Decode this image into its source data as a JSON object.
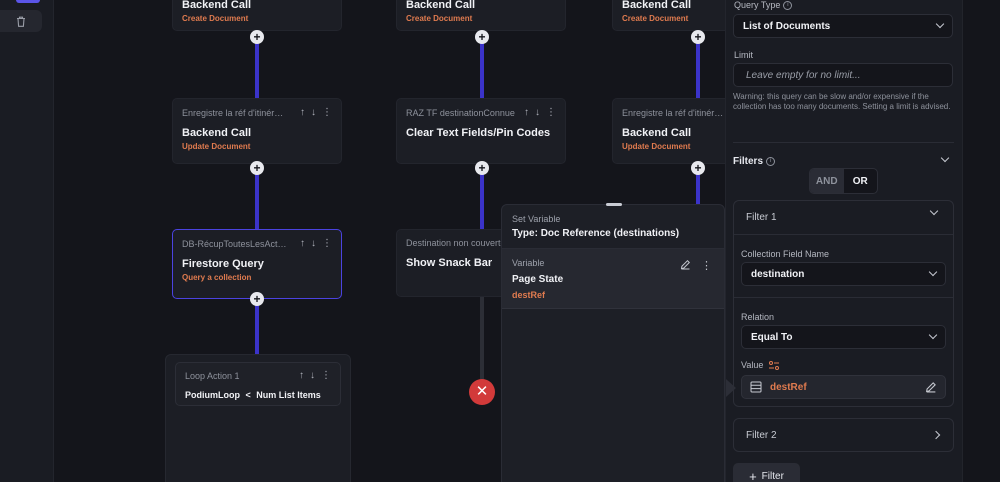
{
  "sidebar": {
    "trash_icon": "trash-icon"
  },
  "nodes": [
    {
      "subtitle": "",
      "title": "Backend Call",
      "type": "Create Document"
    },
    {
      "subtitle": "",
      "title": "Backend Call",
      "type": "Create Document"
    },
    {
      "subtitle": "",
      "title": "Backend Call",
      "type": "Create Document"
    },
    {
      "subtitle": "Enregistre la réf d'itinérair...",
      "title": "Backend Call",
      "type": "Update Document"
    },
    {
      "subtitle": "RAZ TF destinationConnue",
      "title": "Clear Text Fields/Pin Codes",
      "type": ""
    },
    {
      "subtitle": "Enregistre la réf d'itinérair...",
      "title": "Backend Call",
      "type": "Update Document"
    },
    {
      "subtitle": "DB-RécupToutesLesActivi...",
      "title": "Firestore Query",
      "type": "Query a collection"
    },
    {
      "subtitle": "Destination non couverte",
      "title": "Show Snack Bar",
      "type": ""
    }
  ],
  "loop": {
    "subtitle": "Loop Action 1",
    "title_left": "PodiumLoop",
    "op": "<",
    "title_right": "Num List Items"
  },
  "popup": {
    "subtitle": "Set Variable",
    "title": "Type: Doc Reference (destinations)",
    "var_label": "Variable",
    "var_title": "Page State",
    "var_value": "destRef"
  },
  "panel": {
    "query_type_label": "Query Type",
    "query_type_value": "List of Documents",
    "limit_label": "Limit",
    "limit_placeholder": "Leave empty for no limit...",
    "warning": "Warning: this query can be slow and/or expensive if the collection has too many documents. Setting a limit is advised.",
    "filters_title": "Filters",
    "and_label": "AND",
    "or_label": "OR",
    "filter1_title": "Filter 1",
    "field_label": "Collection Field Name",
    "field_value": "destination",
    "relation_label": "Relation",
    "relation_value": "Equal To",
    "value_label": "Value",
    "value_value": "destRef",
    "filter2_title": "Filter 2",
    "add_filter_label": "Filter"
  }
}
